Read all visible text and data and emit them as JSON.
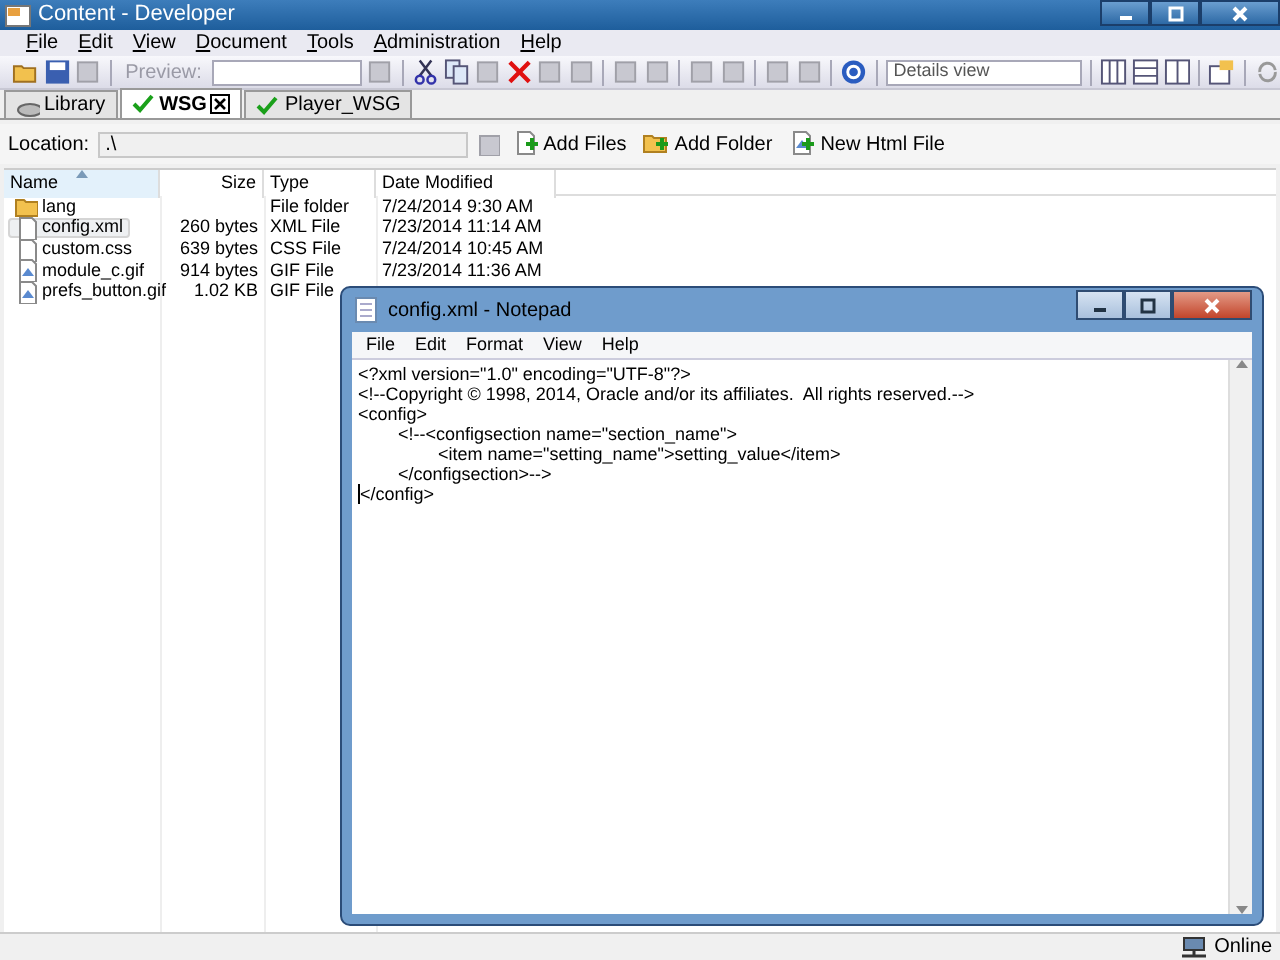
{
  "window": {
    "title": "Content - Developer"
  },
  "menu": [
    "File",
    "Edit",
    "View",
    "Document",
    "Tools",
    "Administration",
    "Help"
  ],
  "toolbar": {
    "preview_label": "Preview:",
    "preview_disabled": true,
    "view_select": "Details view"
  },
  "tabs": [
    {
      "label": "Library",
      "selected": false,
      "checked": false,
      "closable": false
    },
    {
      "label": "WSG",
      "selected": true,
      "checked": true,
      "closable": true
    },
    {
      "label": "Player_WSG",
      "selected": false,
      "checked": true,
      "closable": false
    }
  ],
  "location": {
    "label": "Location:",
    "value": ".\\"
  },
  "actions": [
    {
      "label": "Add Files",
      "kind": "add-file"
    },
    {
      "label": "Add Folder",
      "kind": "add-folder"
    },
    {
      "label": "New Html File",
      "kind": "new-html"
    }
  ],
  "table": {
    "columns": [
      {
        "label": "Name",
        "sorted": true
      },
      {
        "label": "Size",
        "sorted": false
      },
      {
        "label": "Type",
        "sorted": false
      },
      {
        "label": "Date Modified",
        "sorted": false
      }
    ],
    "rows": [
      {
        "kind": "folder",
        "name": "lang",
        "size": "",
        "type": "File folder",
        "date": "7/24/2014 9:30 AM",
        "selected": false
      },
      {
        "kind": "file",
        "name": "config.xml",
        "size": "260 bytes",
        "type": "XML File",
        "date": "7/23/2014 11:14 AM",
        "selected": true
      },
      {
        "kind": "file",
        "name": "custom.css",
        "size": "639 bytes",
        "type": "CSS File",
        "date": "7/24/2014 10:45 AM",
        "selected": false
      },
      {
        "kind": "image",
        "name": "module_c.gif",
        "size": "914 bytes",
        "type": "GIF File",
        "date": "7/23/2014 11:36 AM",
        "selected": false
      },
      {
        "kind": "image",
        "name": "prefs_button.gif",
        "size": "1.02 KB",
        "type": "GIF File",
        "date": "",
        "selected": false
      }
    ]
  },
  "notepad": {
    "title": "config.xml - Notepad",
    "menu": [
      "File",
      "Edit",
      "Format",
      "View",
      "Help"
    ],
    "lines": [
      "<?xml version=\"1.0\" encoding=\"UTF-8\"?>",
      "<!--Copyright © 1998, 2014, Oracle and/or its affiliates.  All rights reserved.-->",
      "<config>",
      "\t<!--<configsection name=\"section_name\">",
      "\t\t<item name=\"setting_name\">setting_value</item>",
      "\t</configsection>-->",
      "</config>"
    ]
  },
  "status_bar": {
    "status": "Online"
  }
}
